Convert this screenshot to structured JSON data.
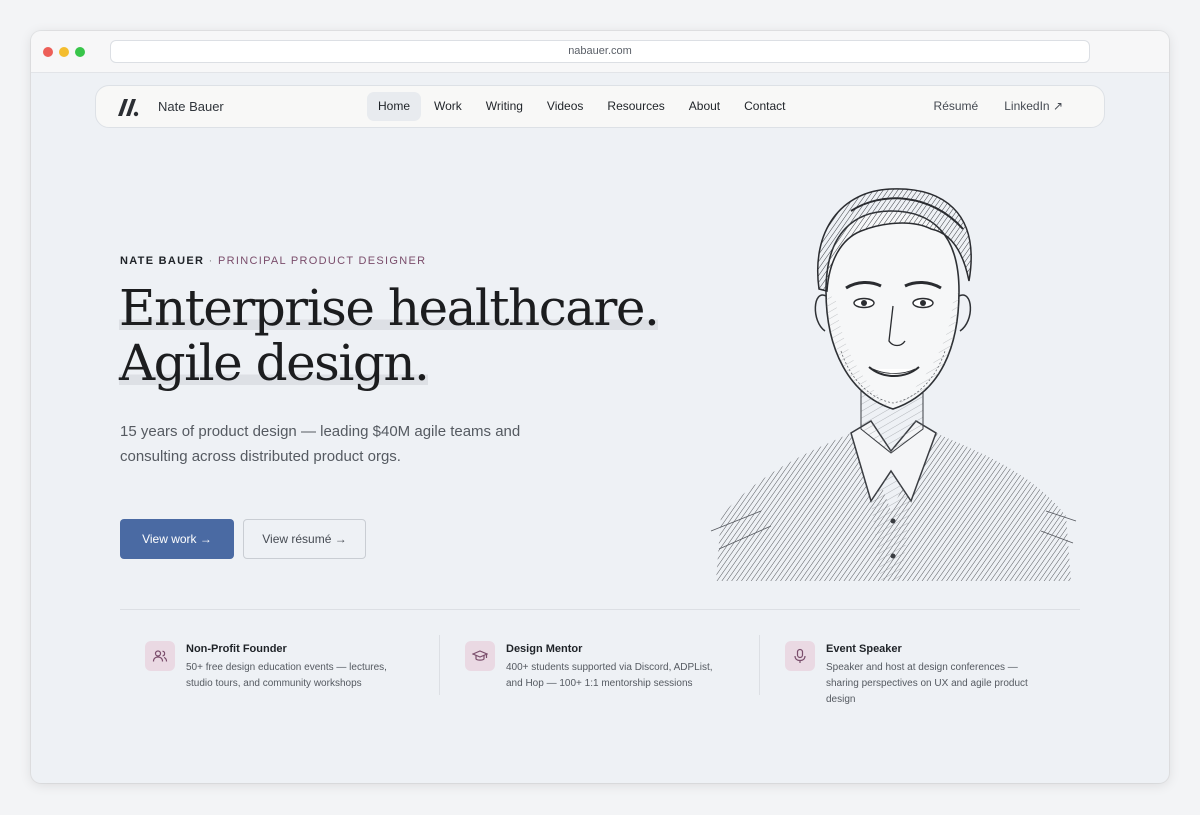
{
  "browser": {
    "url": "nabauer.com"
  },
  "nav": {
    "brand": "Nate Bauer",
    "links": [
      "Home",
      "Work",
      "Writing",
      "Videos",
      "Resources",
      "About",
      "Contact"
    ],
    "active": "Home",
    "right_links": [
      "Résumé",
      "LinkedIn ↗"
    ]
  },
  "hero": {
    "eyebrow_name": "NATE BAUER",
    "eyebrow_sep": " · ",
    "eyebrow_role": "PRINCIPAL PRODUCT DESIGNER",
    "headline_line1": "Enterprise healthcare.",
    "headline_line2": "Agile design.",
    "subtext": "15 years of product design — leading $40M agile teams and consulting across distributed product orgs.",
    "primary_button": "View work  →",
    "secondary_button": "View résumé →"
  },
  "features": [
    {
      "title": "Non-Profit Founder",
      "desc": "50+ free design education events — lectures, studio tours, and community workshops",
      "icon": "users-icon"
    },
    {
      "title": "Design Mentor",
      "desc": "400+ students supported via Discord, ADPList, and Hop — 100+ 1:1 mentorship sessions",
      "icon": "graduation-cap-icon"
    },
    {
      "title": "Event Speaker",
      "desc": "Speaker and host at design conferences — sharing perspectives on UX and agile product design",
      "icon": "microphone-icon"
    }
  ],
  "colors": {
    "accent": "#4a6aa3",
    "role_text": "#7a4d6b",
    "icon_bg": "#ead9e3"
  }
}
